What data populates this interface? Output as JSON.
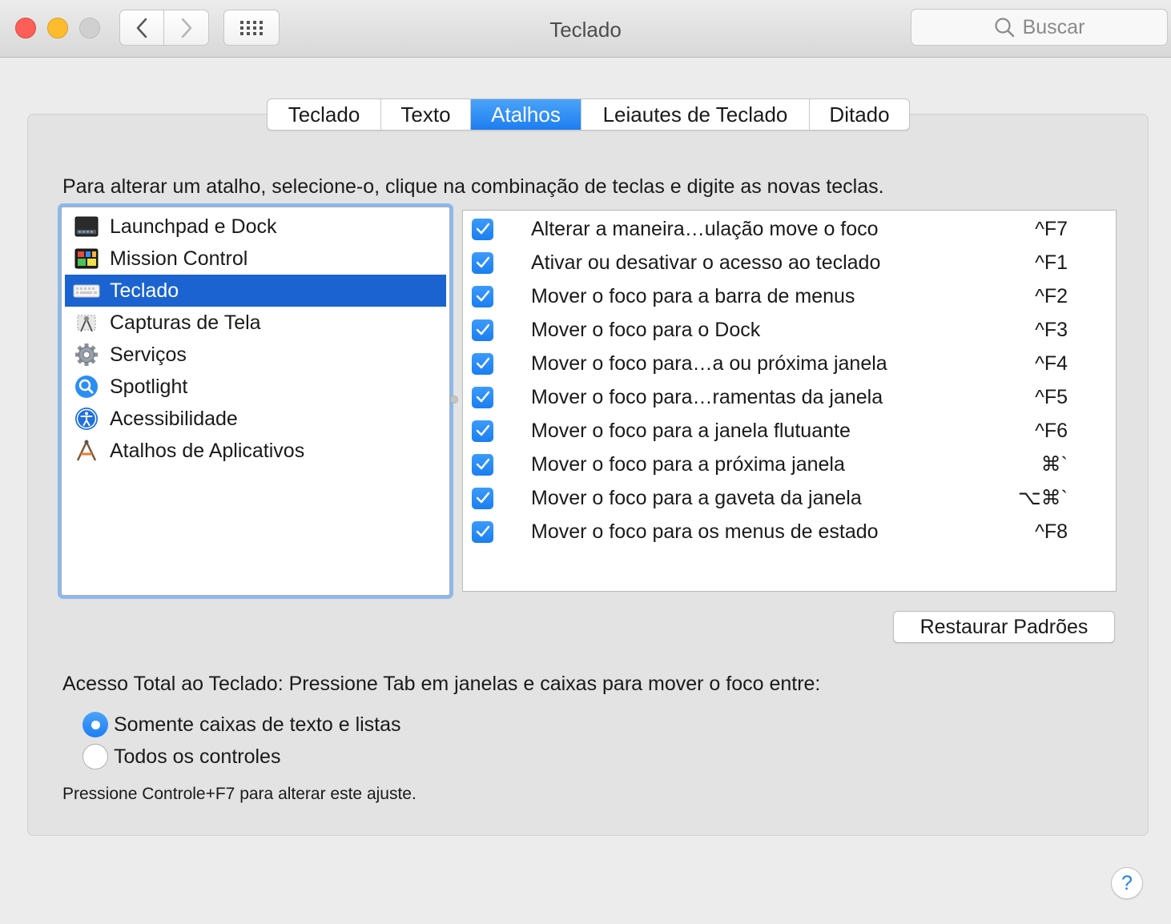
{
  "window": {
    "title": "Teclado"
  },
  "search": {
    "placeholder": "Buscar"
  },
  "tabs": [
    {
      "label": "Teclado",
      "active": false
    },
    {
      "label": "Texto",
      "active": false
    },
    {
      "label": "Atalhos",
      "active": true
    },
    {
      "label": "Leiautes de Teclado",
      "active": false
    },
    {
      "label": "Ditado",
      "active": false
    }
  ],
  "instructions": "Para alterar um atalho, selecione-o, clique na combinação de teclas e digite as novas teclas.",
  "categories": [
    {
      "label": "Launchpad e Dock",
      "icon": "launchpad-dock-icon"
    },
    {
      "label": "Mission Control",
      "icon": "mission-control-icon"
    },
    {
      "label": "Teclado",
      "icon": "keyboard-icon",
      "selected": true
    },
    {
      "label": "Capturas de Tela",
      "icon": "screenshot-icon"
    },
    {
      "label": "Serviços",
      "icon": "gear-icon"
    },
    {
      "label": "Spotlight",
      "icon": "spotlight-icon"
    },
    {
      "label": "Acessibilidade",
      "icon": "accessibility-icon"
    },
    {
      "label": "Atalhos de Aplicativos",
      "icon": "app-shortcuts-icon"
    }
  ],
  "shortcuts": [
    {
      "label": "Alterar a maneira…ulação move o foco",
      "key": "^F7",
      "checked": true
    },
    {
      "label": "Ativar ou desativar o acesso ao teclado",
      "key": "^F1",
      "checked": true
    },
    {
      "label": "Mover o foco para a barra de menus",
      "key": "^F2",
      "checked": true
    },
    {
      "label": "Mover o foco para o Dock",
      "key": "^F3",
      "checked": true
    },
    {
      "label": "Mover o foco para…a ou próxima janela",
      "key": "^F4",
      "checked": true
    },
    {
      "label": "Mover o foco para…ramentas da janela",
      "key": "^F5",
      "checked": true
    },
    {
      "label": "Mover o foco para a janela flutuante",
      "key": "^F6",
      "checked": true
    },
    {
      "label": "Mover o foco para a próxima janela",
      "key": "⌘`",
      "checked": true
    },
    {
      "label": "Mover o foco para a gaveta da janela",
      "key": "⌥⌘`",
      "checked": true
    },
    {
      "label": "Mover o foco para os menus de estado",
      "key": "^F8",
      "checked": true
    }
  ],
  "restore_button": "Restaurar Padrões",
  "full_keyboard_access": {
    "label": "Acesso Total ao Teclado: Pressione Tab em janelas e caixas para mover o foco entre:",
    "options": [
      {
        "label": "Somente caixas de texto e listas",
        "selected": true
      },
      {
        "label": "Todos os controles",
        "selected": false
      }
    ],
    "hint": "Pressione Controle+F7 para alterar este ajuste."
  },
  "help": "?",
  "colors": {
    "accent": "#1d7ef2",
    "selection": "#1a63d0"
  }
}
